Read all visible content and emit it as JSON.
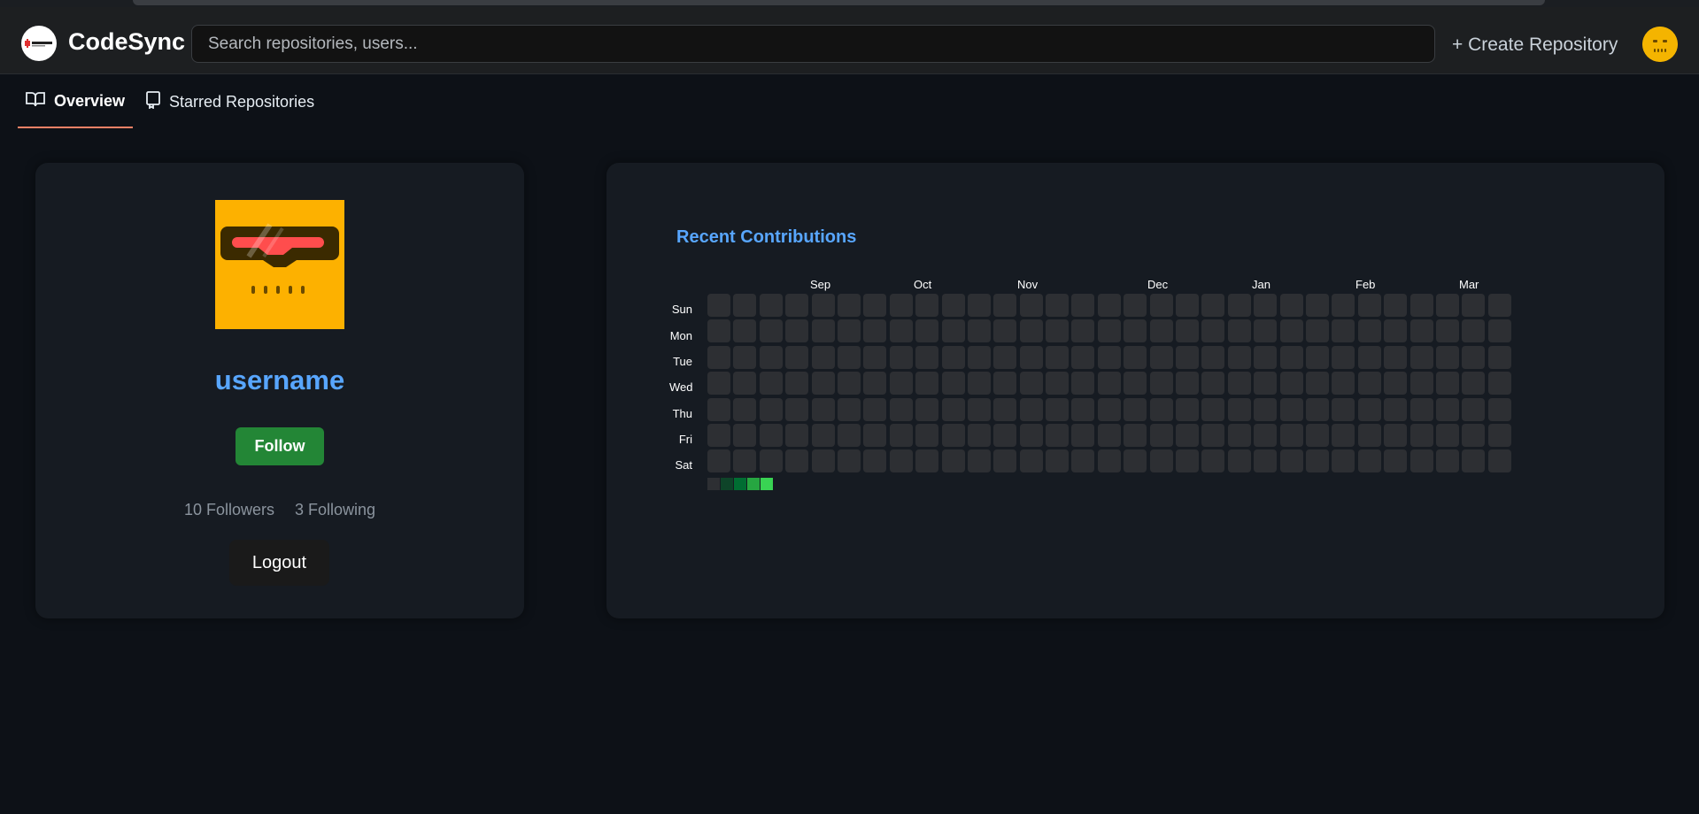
{
  "header": {
    "brand": "CodeSync",
    "logo_icon": "codesync-logo-icon",
    "search_placeholder": "Search repositories, users...",
    "create_label": "+ Create Repository",
    "avatar_icon": "user-avatar-icon"
  },
  "tabs": [
    {
      "label": "Overview",
      "icon": "book-icon",
      "active": true
    },
    {
      "label": "Starred Repositories",
      "icon": "repo-icon",
      "active": false
    }
  ],
  "profile": {
    "avatar_icon": "profile-avatar-icon",
    "username": "username",
    "follow_label": "Follow",
    "followers": "10 Followers",
    "following": "3 Following",
    "logout_label": "Logout"
  },
  "contributions": {
    "title": "Recent Contributions",
    "months": [
      "Sep",
      "Oct",
      "Nov",
      "Dec",
      "Jan",
      "Feb",
      "Mar"
    ],
    "weekdays": [
      "Sun",
      "Mon",
      "Tue",
      "Wed",
      "Thu",
      "Fri",
      "Sat"
    ],
    "weeks": 31,
    "legend_colors": [
      "#2d2f33",
      "#0e4429",
      "#006d32",
      "#26a641",
      "#39d353"
    ]
  },
  "colors": {
    "accent": "#58a6ff",
    "follow_green": "#238636",
    "tab_underline": "#f78166",
    "empty_cell": "#2d2f33"
  }
}
